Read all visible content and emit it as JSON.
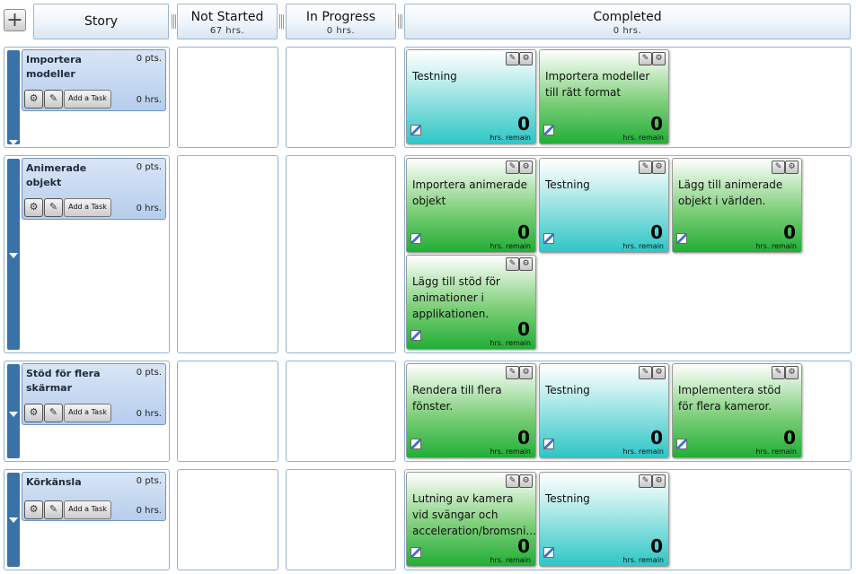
{
  "toolbar": {
    "add_icon": "plus-icon"
  },
  "columns": {
    "story": {
      "title": "Story"
    },
    "not_started": {
      "title": "Not Started",
      "hours": "67 hrs."
    },
    "in_progress": {
      "title": "In Progress",
      "hours": "0 hrs."
    },
    "completed": {
      "title": "Completed",
      "hours": "0 hrs."
    }
  },
  "stories": [
    {
      "title": "Importera modeller",
      "points": "0 pts.",
      "hours": "0 hrs.",
      "add_task": "Add a Task",
      "completed": [
        {
          "name": "Testning",
          "color": "cyan",
          "remain": "0",
          "remain_label": "hrs. remain"
        },
        {
          "name": "Importera modeller till rätt format",
          "color": "green",
          "remain": "0",
          "remain_label": "hrs. remain"
        }
      ]
    },
    {
      "title": "Animerade objekt",
      "points": "0 pts.",
      "hours": "0 hrs.",
      "add_task": "Add a Task",
      "completed": [
        {
          "name": "Importera animerade objekt",
          "color": "green",
          "remain": "0",
          "remain_label": "hrs. remain"
        },
        {
          "name": "Testning",
          "color": "cyan",
          "remain": "0",
          "remain_label": "hrs. remain"
        },
        {
          "name": "Lägg till animerade objekt i världen.",
          "color": "green",
          "remain": "0",
          "remain_label": "hrs. remain"
        },
        {
          "name": "Lägg till stöd för animationer i applikationen.",
          "color": "green",
          "remain": "0",
          "remain_label": "hrs. remain"
        }
      ]
    },
    {
      "title": "Stöd för flera skärmar",
      "points": "0 pts.",
      "hours": "0 hrs.",
      "add_task": "Add a Task",
      "completed": [
        {
          "name": "Rendera till flera fönster.",
          "color": "green",
          "remain": "0",
          "remain_label": "hrs. remain"
        },
        {
          "name": "Testning",
          "color": "cyan",
          "remain": "0",
          "remain_label": "hrs. remain"
        },
        {
          "name": "Implementera stöd för flera kameror.",
          "color": "green",
          "remain": "0",
          "remain_label": "hrs. remain"
        }
      ]
    },
    {
      "title": "Körkänsla",
      "points": "0 pts.",
      "hours": "0 hrs.",
      "add_task": "Add a Task",
      "completed": [
        {
          "name": "Lutning av kamera vid svängar och acceleration/bromsni....",
          "color": "green",
          "remain": "0",
          "remain_label": "hrs. remain"
        },
        {
          "name": "Testning",
          "color": "cyan",
          "remain": "0",
          "remain_label": "hrs. remain"
        }
      ]
    }
  ],
  "colors": {
    "story_bar": "#3a72a6",
    "task_green": "#21ae36",
    "task_cyan": "#2ec6c6",
    "border": "#8fb3d8"
  }
}
